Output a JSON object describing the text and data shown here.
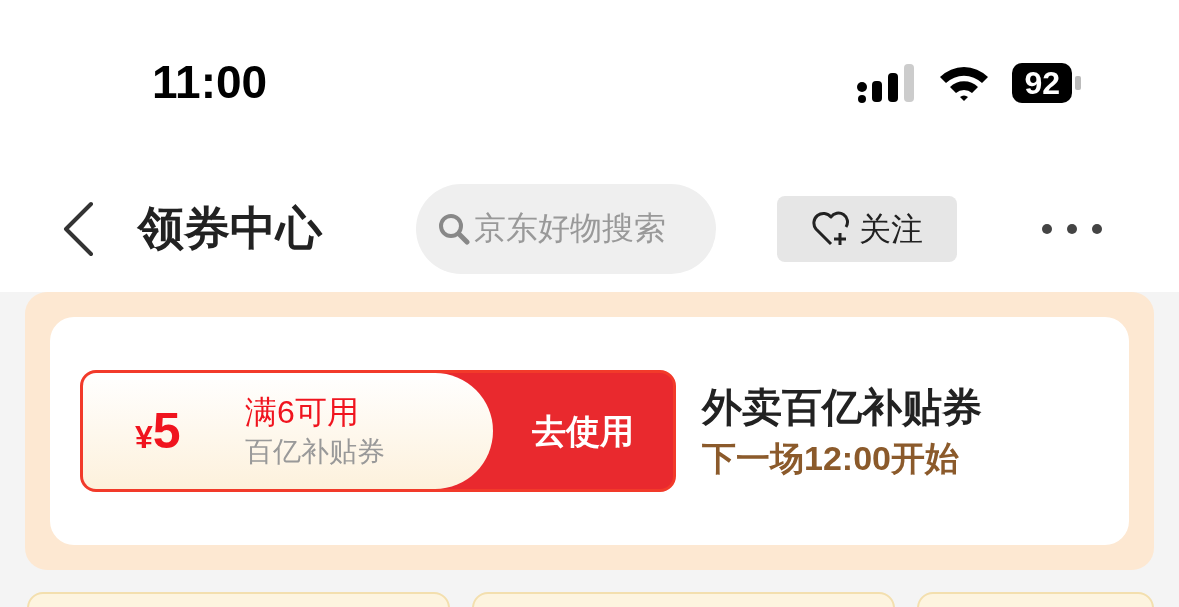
{
  "status_bar": {
    "time": "11:00",
    "battery": "92"
  },
  "nav": {
    "title": "领券中心",
    "search": {
      "placeholder": "京东好物搜索"
    },
    "follow_button": "关注"
  },
  "coupon": {
    "currency": "¥",
    "amount": "5",
    "condition": "满6可用",
    "type": "百亿补贴券",
    "action": "去使用",
    "title": "外卖百亿补贴券",
    "note": "下一场12:00开始"
  }
}
